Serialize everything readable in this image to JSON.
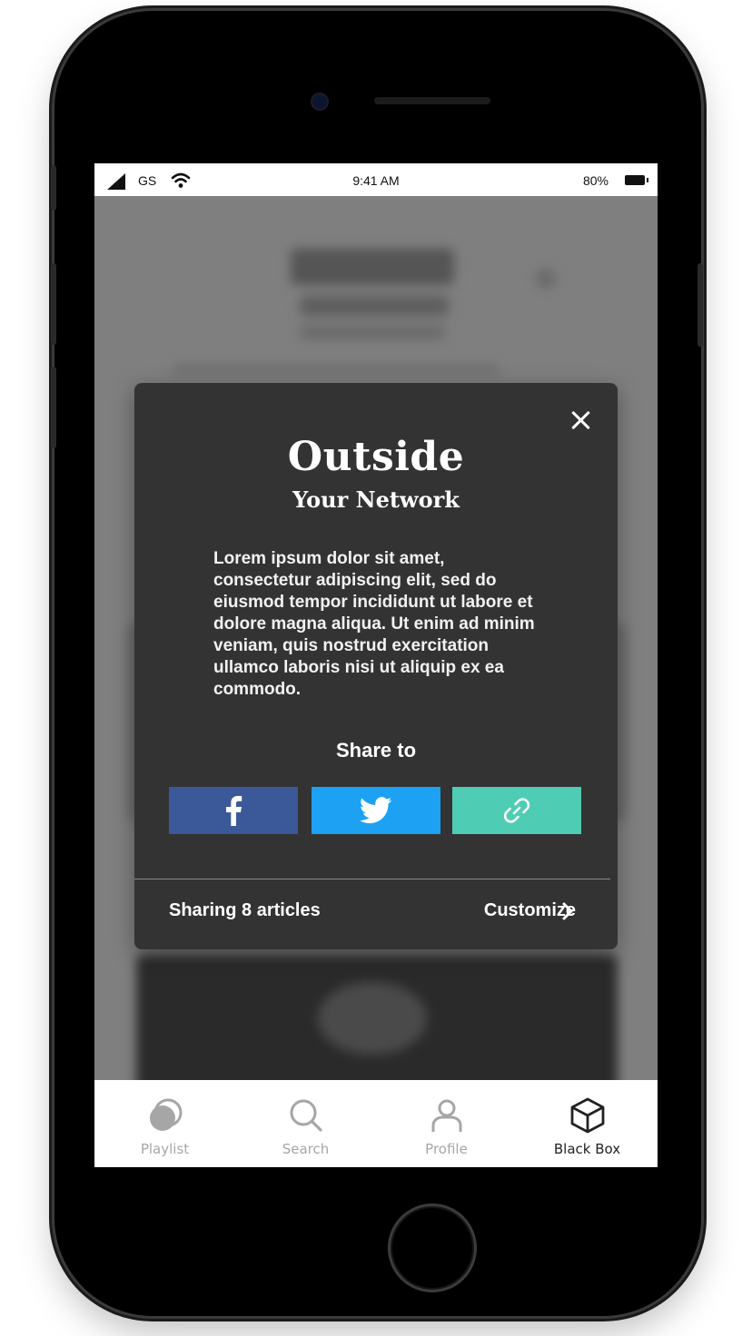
{
  "status_bar": {
    "carrier": "GS",
    "time": "9:41 AM",
    "battery": "80%"
  },
  "modal": {
    "title": "Outside",
    "subtitle": "Your Network",
    "body": "Lorem ipsum dolor sit amet, consectetur adipiscing elit, sed do eiusmod tempor incididunt ut labore et dolore magna aliqua. Ut enim ad minim veniam, quis nostrud exercitation ullamco laboris nisi ut aliquip ex ea commodo.",
    "share_heading": "Share to",
    "share_buttons": [
      {
        "network": "facebook",
        "icon": "facebook-icon",
        "color": "#3b5998"
      },
      {
        "network": "twitter",
        "icon": "twitter-icon",
        "color": "#1da1f2"
      },
      {
        "network": "copy-link",
        "icon": "link-icon",
        "color": "#4fcdb4"
      }
    ],
    "footer_left": "Sharing 8 articles",
    "footer_right": "Customize"
  },
  "tab_bar": {
    "items": [
      {
        "label": "Playlist",
        "icon": "playlist-icon",
        "active": false
      },
      {
        "label": "Search",
        "icon": "search-icon",
        "active": false
      },
      {
        "label": "Profile",
        "icon": "profile-icon",
        "active": false
      },
      {
        "label": "Black Box",
        "icon": "cube-icon",
        "active": true
      }
    ]
  }
}
